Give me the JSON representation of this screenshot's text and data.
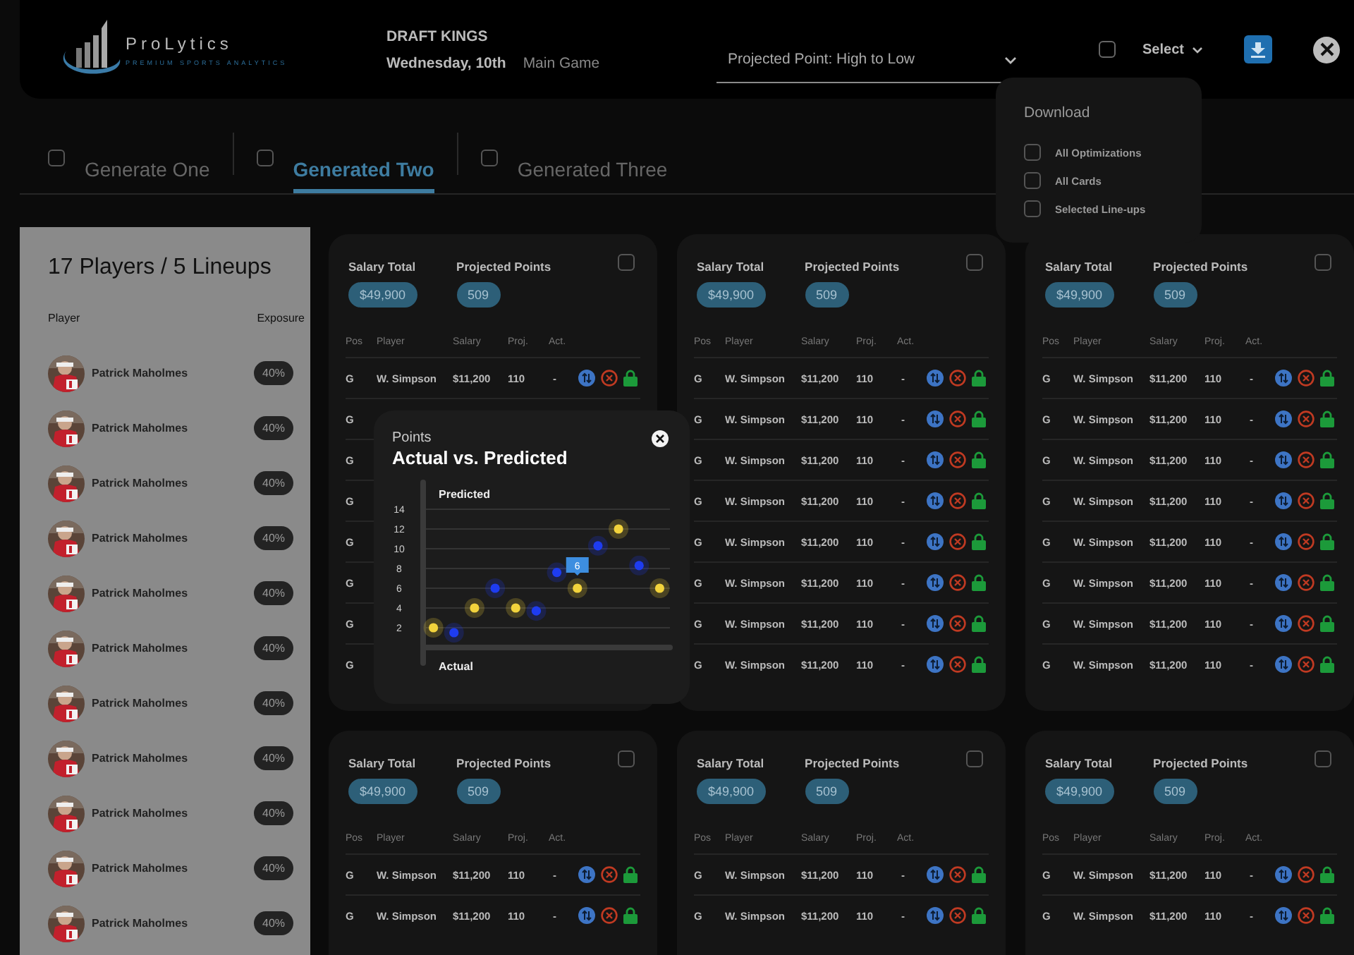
{
  "header": {
    "brand": "ProLytics",
    "tagline": "PREMIUM SPORTS ANALYTICS",
    "site": "DRAFT KINGS",
    "date": "Wednesday, 10th",
    "game": "Main Game",
    "sort": {
      "value": "Projected Point: High to Low"
    },
    "select": {
      "label": "Select",
      "checked": false
    }
  },
  "download_menu": {
    "title": "Download",
    "options": [
      {
        "label": "All Optimizations",
        "checked": false
      },
      {
        "label": "All Cards",
        "checked": false
      },
      {
        "label": "Selected Line-ups",
        "checked": false
      }
    ]
  },
  "tabs": [
    {
      "label": "Generate One",
      "checked": false,
      "selected": false
    },
    {
      "label": "Generated Two",
      "checked": false,
      "selected": true
    },
    {
      "label": "Generated Three",
      "checked": false,
      "selected": false
    }
  ],
  "players_panel": {
    "title": "17 Players / 5 Lineups",
    "columns": [
      "Player",
      "Exposure"
    ],
    "players": [
      {
        "name": "Patrick Maholmes",
        "exposure": "40%"
      },
      {
        "name": "Patrick Maholmes",
        "exposure": "40%"
      },
      {
        "name": "Patrick Maholmes",
        "exposure": "40%"
      },
      {
        "name": "Patrick Maholmes",
        "exposure": "40%"
      },
      {
        "name": "Patrick Maholmes",
        "exposure": "40%"
      },
      {
        "name": "Patrick Maholmes",
        "exposure": "40%"
      },
      {
        "name": "Patrick Maholmes",
        "exposure": "40%"
      },
      {
        "name": "Patrick Maholmes",
        "exposure": "40%"
      },
      {
        "name": "Patrick Maholmes",
        "exposure": "40%"
      },
      {
        "name": "Patrick Maholmes",
        "exposure": "40%"
      },
      {
        "name": "Patrick Maholmes",
        "exposure": "40%"
      }
    ]
  },
  "cards": [
    {
      "salary_label": "Salary Total",
      "salary_total": "$49,900",
      "points_label": "Projected Points",
      "projected_points": "509",
      "checked": false,
      "columns": [
        "Pos",
        "Player",
        "Salary",
        "Proj.",
        "Act."
      ],
      "rows": [
        {
          "pos": "G",
          "player": "W. Simpson",
          "salary": "$11,200",
          "proj": "110",
          "act": "-"
        },
        {
          "pos": "G"
        },
        {
          "pos": "G"
        },
        {
          "pos": "G"
        },
        {
          "pos": "G"
        },
        {
          "pos": "G"
        },
        {
          "pos": "G"
        },
        {
          "pos": "G"
        }
      ]
    },
    {
      "salary_label": "Salary Total",
      "salary_total": "$49,900",
      "points_label": "Projected Points",
      "projected_points": "509",
      "checked": false,
      "columns": [
        "Pos",
        "Player",
        "Salary",
        "Proj.",
        "Act."
      ],
      "rows": [
        {
          "pos": "G",
          "player": "W. Simpson",
          "salary": "$11,200",
          "proj": "110",
          "act": "-"
        },
        {
          "pos": "G",
          "player": "W. Simpson",
          "salary": "$11,200",
          "proj": "110",
          "act": "-"
        },
        {
          "pos": "G",
          "player": "W. Simpson",
          "salary": "$11,200",
          "proj": "110",
          "act": "-"
        },
        {
          "pos": "G",
          "player": "W. Simpson",
          "salary": "$11,200",
          "proj": "110",
          "act": "-"
        },
        {
          "pos": "G",
          "player": "W. Simpson",
          "salary": "$11,200",
          "proj": "110",
          "act": "-"
        },
        {
          "pos": "G",
          "player": "W. Simpson",
          "salary": "$11,200",
          "proj": "110",
          "act": "-"
        },
        {
          "pos": "G",
          "player": "W. Simpson",
          "salary": "$11,200",
          "proj": "110",
          "act": "-"
        },
        {
          "pos": "G",
          "player": "W. Simpson",
          "salary": "$11,200",
          "proj": "110",
          "act": "-"
        }
      ]
    },
    {
      "salary_label": "Salary Total",
      "salary_total": "$49,900",
      "points_label": "Projected Points",
      "projected_points": "509",
      "checked": false,
      "columns": [
        "Pos",
        "Player",
        "Salary",
        "Proj.",
        "Act."
      ],
      "rows": [
        {
          "pos": "G",
          "player": "W. Simpson",
          "salary": "$11,200",
          "proj": "110",
          "act": "-"
        },
        {
          "pos": "G",
          "player": "W. Simpson",
          "salary": "$11,200",
          "proj": "110",
          "act": "-"
        },
        {
          "pos": "G",
          "player": "W. Simpson",
          "salary": "$11,200",
          "proj": "110",
          "act": "-"
        },
        {
          "pos": "G",
          "player": "W. Simpson",
          "salary": "$11,200",
          "proj": "110",
          "act": "-"
        },
        {
          "pos": "G",
          "player": "W. Simpson",
          "salary": "$11,200",
          "proj": "110",
          "act": "-"
        },
        {
          "pos": "G",
          "player": "W. Simpson",
          "salary": "$11,200",
          "proj": "110",
          "act": "-"
        },
        {
          "pos": "G",
          "player": "W. Simpson",
          "salary": "$11,200",
          "proj": "110",
          "act": "-"
        },
        {
          "pos": "G",
          "player": "W. Simpson",
          "salary": "$11,200",
          "proj": "110",
          "act": "-"
        }
      ]
    },
    {
      "salary_label": "Salary Total",
      "salary_total": "$49,900",
      "points_label": "Projected Points",
      "projected_points": "509",
      "checked": false,
      "columns": [
        "Pos",
        "Player",
        "Salary",
        "Proj.",
        "Act."
      ],
      "rows": [
        {
          "pos": "G",
          "player": "W. Simpson",
          "salary": "$11,200",
          "proj": "110",
          "act": "-"
        },
        {
          "pos": "G",
          "player": "W. Simpson",
          "salary": "$11,200",
          "proj": "110",
          "act": "-"
        }
      ]
    },
    {
      "salary_label": "Salary Total",
      "salary_total": "$49,900",
      "points_label": "Projected Points",
      "projected_points": "509",
      "checked": false,
      "columns": [
        "Pos",
        "Player",
        "Salary",
        "Proj.",
        "Act."
      ],
      "rows": [
        {
          "pos": "G",
          "player": "W. Simpson",
          "salary": "$11,200",
          "proj": "110",
          "act": "-"
        },
        {
          "pos": "G",
          "player": "W. Simpson",
          "salary": "$11,200",
          "proj": "110",
          "act": "-"
        }
      ]
    },
    {
      "salary_label": "Salary Total",
      "salary_total": "$49,900",
      "points_label": "Projected Points",
      "projected_points": "509",
      "checked": false,
      "columns": [
        "Pos",
        "Player",
        "Salary",
        "Proj.",
        "Act."
      ],
      "rows": [
        {
          "pos": "G",
          "player": "W. Simpson",
          "salary": "$11,200",
          "proj": "110",
          "act": "-"
        },
        {
          "pos": "G",
          "player": "W. Simpson",
          "salary": "$11,200",
          "proj": "110",
          "act": "-"
        }
      ]
    }
  ],
  "popup": {
    "subtitle": "Points",
    "chart_data": {
      "type": "scatter",
      "title": "Actual vs. Predicted",
      "xlabel": "Actual",
      "ylabel": "Predicted",
      "grid": true,
      "ylim": [
        0,
        14
      ],
      "yticks": [
        2,
        4,
        6,
        8,
        10,
        12,
        14
      ],
      "categories": [
        null,
        null,
        null,
        null,
        null,
        null,
        null,
        null,
        null,
        null,
        null,
        null
      ],
      "series": [
        {
          "color": "#f2d33c",
          "values": [
            2,
            null,
            4,
            null,
            4,
            null,
            null,
            6,
            null,
            12,
            null,
            6
          ]
        },
        {
          "color": "#1e3cf0",
          "values": [
            null,
            1.5,
            null,
            6,
            null,
            3.7,
            7.6,
            null,
            10.3,
            null,
            8.3,
            null
          ]
        }
      ],
      "annotations": [
        "6"
      ]
    }
  }
}
